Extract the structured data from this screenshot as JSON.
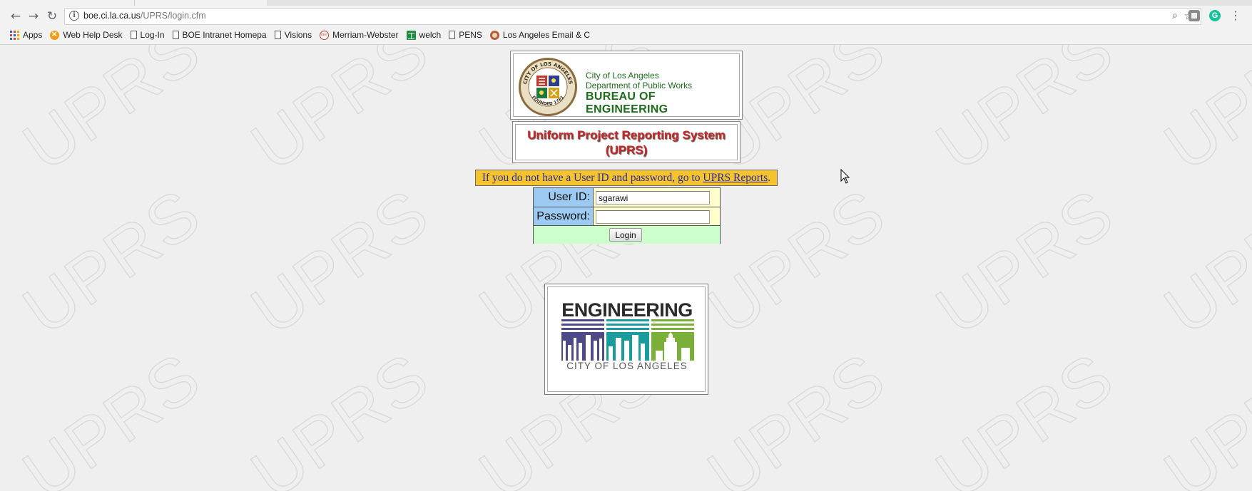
{
  "browser": {
    "url_host": "boe.ci.la.ca.us",
    "url_path": "/UPRS/login.cfm",
    "bookmarks": [
      {
        "label": "Apps",
        "icon": "apps-grid-icon"
      },
      {
        "label": "Web Help Desk",
        "icon": "web-help-desk-icon"
      },
      {
        "label": "Log-In",
        "icon": "page-icon"
      },
      {
        "label": "BOE Intranet Homepa",
        "icon": "page-icon"
      },
      {
        "label": "Visions",
        "icon": "page-icon"
      },
      {
        "label": "Merriam-Webster",
        "icon": "merriam-webster-icon"
      },
      {
        "label": "welch",
        "icon": "sheets-icon"
      },
      {
        "label": "PENS",
        "icon": "page-icon"
      },
      {
        "label": "Los Angeles Email & C",
        "icon": "la-seal-icon"
      }
    ]
  },
  "header": {
    "line1": "City of Los Angeles",
    "line2": "Department of Public Works",
    "line3": "BUREAU OF ENGINEERING",
    "seal_text": "CITY OF LOS ANGELES",
    "seal_founded": "FOUNDED 1781"
  },
  "title": {
    "line1": "Uniform Project Reporting System",
    "line2": "(UPRS)"
  },
  "notice": {
    "text": "If you do not have a User ID and password, go to ",
    "link": "UPRS Reports",
    "after": "."
  },
  "login": {
    "userid_label": "User ID:",
    "userid_value": "sgarawi",
    "password_label": "Password:",
    "password_value": "",
    "button": "Login"
  },
  "logo": {
    "word": "ENGINEERING",
    "city": "CITY OF LOS ANGELES",
    "colors": [
      "#4d4a87",
      "#1a9c9c",
      "#7ab03a"
    ]
  },
  "watermark_text": "UPRS",
  "colors": {
    "notice_bg": "#f5c32e",
    "label_bg": "#9ccaf2",
    "field_bg": "#ffffcc",
    "button_row_bg": "#ccffcc",
    "title_red": "#c62828",
    "header_green": "#1e6b1e"
  }
}
